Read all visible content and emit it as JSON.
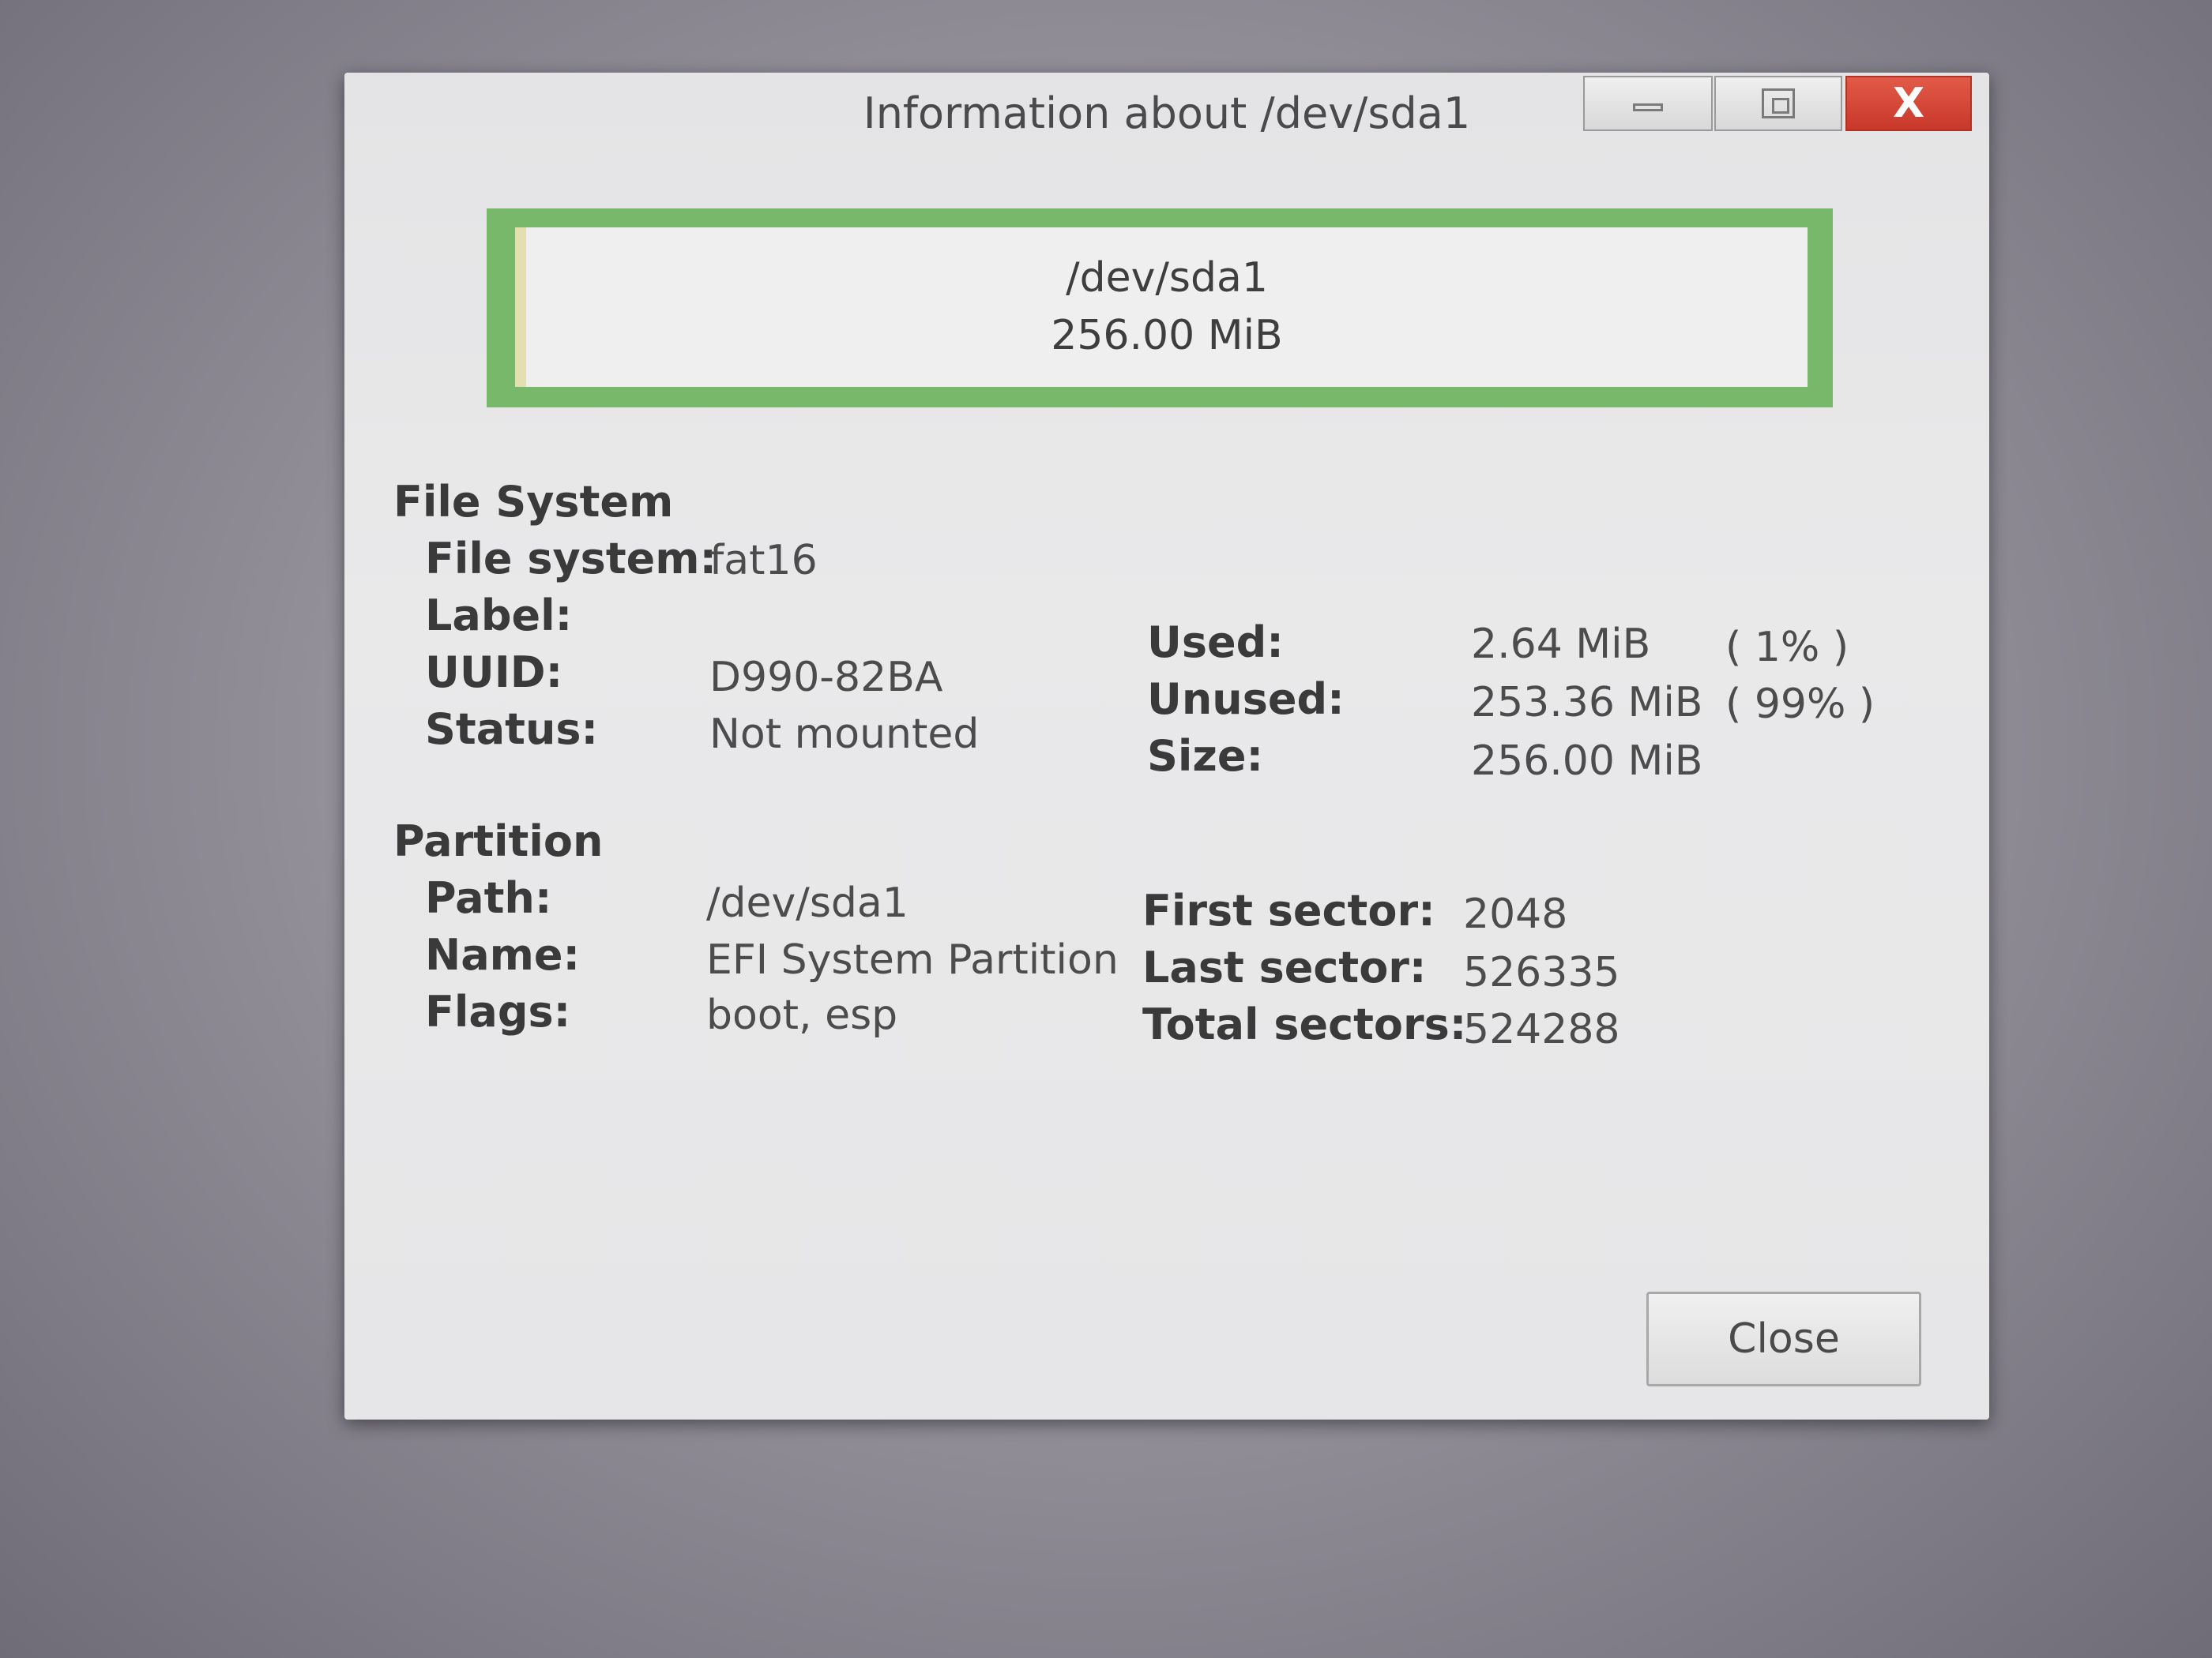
{
  "window": {
    "title": "Information about /dev/sda1",
    "close_glyph": "X",
    "icons": [
      "minimize-icon",
      "maximize-icon",
      "close-icon"
    ]
  },
  "partition_graph": {
    "path": "/dev/sda1",
    "size": "256.00 MiB",
    "colors": {
      "border": "#78b86b",
      "used": "#e3dfae",
      "unused": "#efeff0"
    }
  },
  "file_system": {
    "heading": "File System",
    "fs_label": "File system:",
    "fs_value": "fat16",
    "label_label": "Label:",
    "label_value": "",
    "uuid_label": "UUID:",
    "uuid_value": "D990-82BA",
    "status_label": "Status:",
    "status_value": "Not mounted",
    "used_label": "Used:",
    "used_value": "2.64 MiB",
    "used_pct": "( 1% )",
    "unused_label": "Unused:",
    "unused_value": "253.36 MiB",
    "unused_pct": "( 99% )",
    "size_label": "Size:",
    "size_value": "256.00 MiB"
  },
  "partition": {
    "heading": "Partition",
    "path_label": "Path:",
    "path_value": "/dev/sda1",
    "name_label": "Name:",
    "name_value": "EFI System Partition",
    "flags_label": "Flags:",
    "flags_value": "boot, esp",
    "first_sector_label": "First sector:",
    "first_sector_value": "2048",
    "last_sector_label": "Last sector:",
    "last_sector_value": "526335",
    "total_sectors_label": "Total sectors:",
    "total_sectors_value": "524288"
  },
  "buttons": {
    "close": "Close"
  }
}
